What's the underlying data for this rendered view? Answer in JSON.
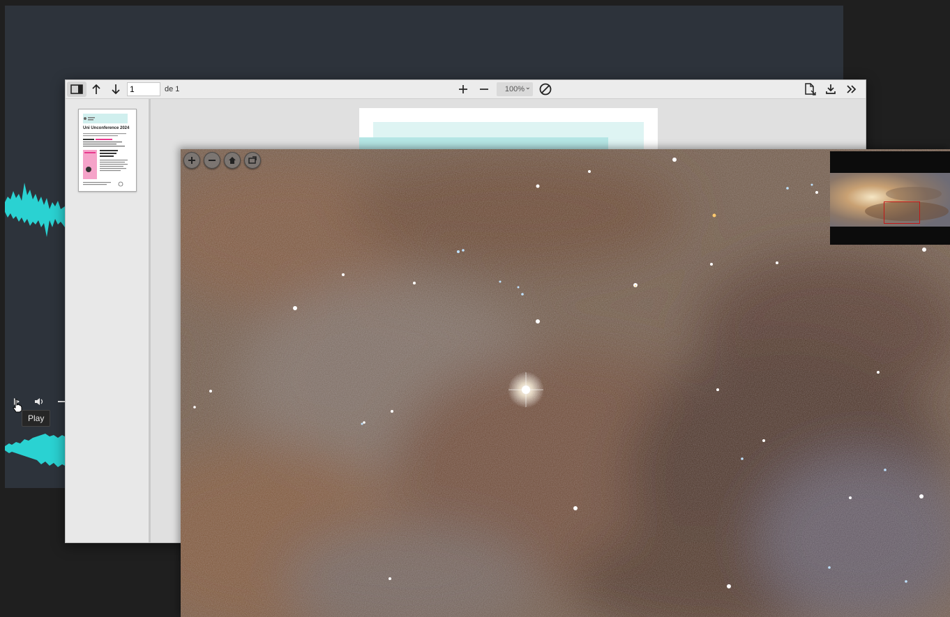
{
  "audio_player": {
    "tooltip": "Play",
    "icons": [
      "play-icon",
      "volume-icon"
    ],
    "accent_color": "#2ad2d2"
  },
  "pdf_viewer": {
    "current_page": "1",
    "page_of": "de 1",
    "zoom": "100%",
    "thumbnail": {
      "title": "Uni Unconference 2024"
    },
    "icons": [
      "sidebar-toggle-icon",
      "arrow-up-icon",
      "arrow-down-icon",
      "zoom-in-icon",
      "zoom-out-icon",
      "chevron-down-icon",
      "no-entry-icon",
      "document-icon",
      "download-icon",
      "double-chevron-right-icon"
    ]
  },
  "image_viewer": {
    "icons": [
      "zoom-in-icon",
      "zoom-out-icon",
      "home-icon",
      "fullscreen-icon"
    ],
    "navigator_rect_color": "#c21818"
  }
}
